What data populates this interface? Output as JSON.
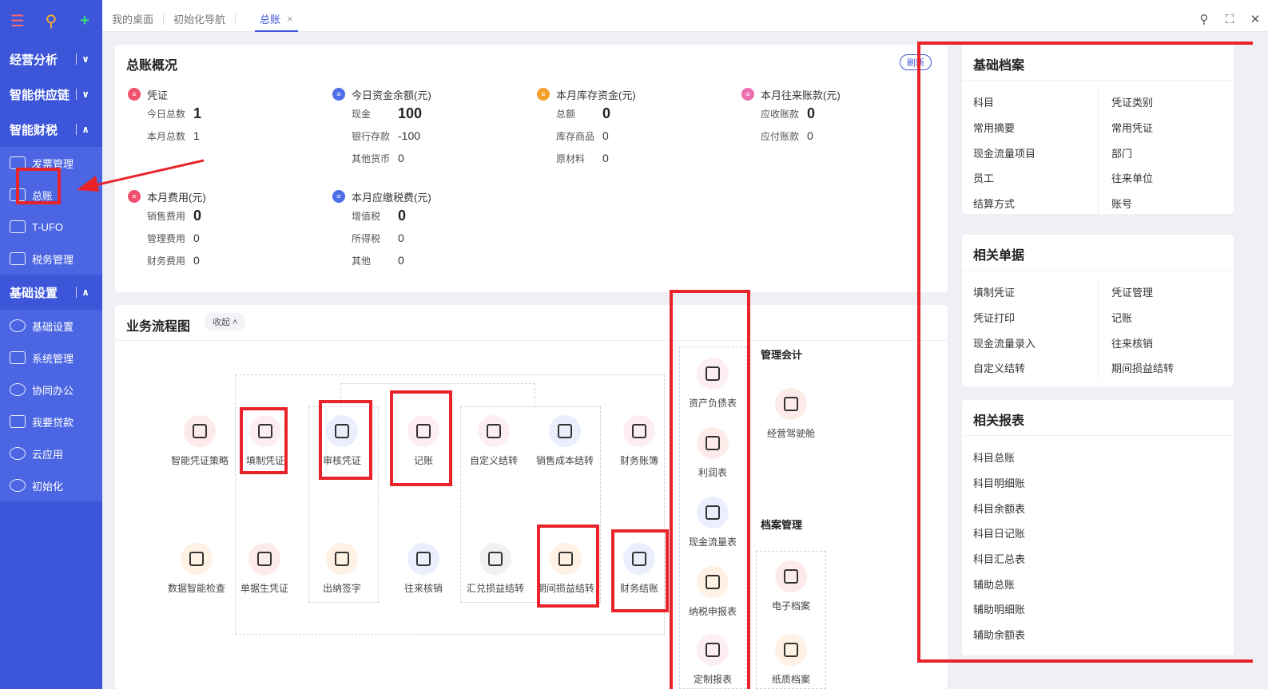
{
  "sidebar": {
    "groups": [
      {
        "label": "经营分析",
        "arrow": "∨"
      },
      {
        "label": "智能供应链",
        "arrow": "∨"
      },
      {
        "label": "智能财税",
        "arrow": "∧"
      }
    ],
    "finance_items": [
      {
        "label": "发票管理",
        "icon": "invoice-icon"
      },
      {
        "label": "总账",
        "icon": "ledger-icon"
      },
      {
        "label": "T-UFO",
        "icon": "report-icon"
      },
      {
        "label": "税务管理",
        "icon": "tax-icon"
      }
    ],
    "base_group": {
      "label": "基础设置",
      "arrow": "∧"
    },
    "base_items": [
      {
        "label": "基础设置",
        "icon": "settings-icon"
      },
      {
        "label": "系统管理",
        "icon": "system-icon"
      },
      {
        "label": "协同办公",
        "icon": "collab-icon"
      },
      {
        "label": "我要贷款",
        "icon": "loan-icon"
      },
      {
        "label": "云应用",
        "icon": "cloud-icon"
      },
      {
        "label": "初始化",
        "icon": "init-icon"
      }
    ]
  },
  "tabs": [
    {
      "label": "我的桌面"
    },
    {
      "label": "初始化导航"
    },
    {
      "label": "总账",
      "close": "×"
    }
  ],
  "summary": {
    "title": "总账概况",
    "refresh": "刷新",
    "voucher": {
      "title": "凭证",
      "rows": [
        {
          "k": "今日总数",
          "v": "1"
        },
        {
          "k": "本月总数",
          "v": "1"
        }
      ]
    },
    "cash": {
      "title": "今日资金余额(元)",
      "rows": [
        {
          "k": "现金",
          "v": "100"
        },
        {
          "k": "银行存款",
          "v": "-100"
        },
        {
          "k": "其他货币",
          "v": "0"
        }
      ]
    },
    "stock": {
      "title": "本月库存资金(元)",
      "rows": [
        {
          "k": "总额",
          "v": "0"
        },
        {
          "k": "库存商品",
          "v": "0"
        },
        {
          "k": "原材料",
          "v": "0"
        }
      ]
    },
    "ar": {
      "title": "本月往来账款(元)",
      "rows": [
        {
          "k": "应收账款",
          "v": "0"
        },
        {
          "k": "应付账款",
          "v": "0"
        }
      ]
    },
    "expense": {
      "title": "本月费用(元)",
      "rows": [
        {
          "k": "销售费用",
          "v": "0"
        },
        {
          "k": "管理费用",
          "v": "0"
        },
        {
          "k": "财务费用",
          "v": "0"
        }
      ]
    },
    "tax": {
      "title": "本月应缴税费(元)",
      "rows": [
        {
          "k": "增值税",
          "v": "0"
        },
        {
          "k": "所得税",
          "v": "0"
        },
        {
          "k": "其他",
          "v": "0"
        }
      ]
    }
  },
  "flow": {
    "title": "业务流程图",
    "collapse": "收起 ˄",
    "nodes": {
      "smart_policy": "智能凭证策略",
      "fill_voucher": "填制凭证",
      "audit_voucher": "审核凭证",
      "post": "记账",
      "custom_close": "自定义结转",
      "cost_close": "销售成本结转",
      "books": "财务账簿",
      "data_check": "数据智能检查",
      "doc_voucher": "单据生凭证",
      "cashier_sign": "出纳签字",
      "ar_verify": "往来核销",
      "fx_close": "汇兑损益结转",
      "period_close": "期间损益结转",
      "fin_close": "财务结账",
      "balance": "资产负债表",
      "profit": "利润表",
      "cashflow": "现金流量表",
      "tax_report": "纳税申报表",
      "custom_report": "定制报表",
      "cockpit": "经营驾驶舱",
      "e_archive": "电子档案",
      "paper_archive": "纸质档案"
    },
    "mgmt_title": "管理会计",
    "archive_title": "档案管理"
  },
  "basic": {
    "title": "基础档案",
    "items": [
      "科目",
      "凭证类别",
      "常用摘要",
      "常用凭证",
      "现金流量项目",
      "部门",
      "员工",
      "往来单位",
      "结算方式",
      "账号"
    ]
  },
  "docs": {
    "title": "相关单据",
    "items": [
      "填制凭证",
      "凭证管理",
      "凭证打印",
      "记账",
      "现金流量录入",
      "往来核销",
      "自定义结转",
      "期间损益结转"
    ]
  },
  "reports": {
    "title": "相关报表",
    "items": [
      "科目总账",
      "科目明细账",
      "科目余额表",
      "科目日记账",
      "科目汇总表",
      "辅助总账",
      "辅助明细账",
      "辅助余额表"
    ]
  },
  "colors": {
    "sidebar": "#3d56d9",
    "highlight": "#e8232a",
    "accent": "#3d56d9"
  }
}
